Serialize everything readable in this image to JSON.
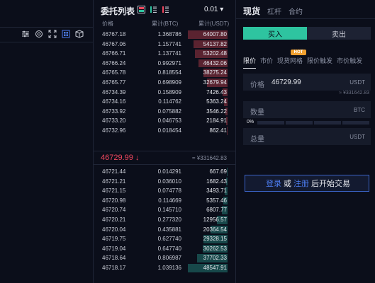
{
  "left_toolbar": {
    "icons": [
      "settings-sliders-icon",
      "eye-icon",
      "fullscreen-icon",
      "grid-layout-icon",
      "cube-icon"
    ]
  },
  "order_book": {
    "title": "委托列表",
    "precision": "0.01",
    "columns": {
      "price": "价格",
      "amount": "累计(BTC)",
      "total": "累计(USDT)"
    },
    "asks": [
      {
        "price": "46767.18",
        "amount": "1.368786",
        "total": "64007.80",
        "depth": 1.0
      },
      {
        "price": "46767.06",
        "amount": "1.157741",
        "total": "54137.82",
        "depth": 0.85
      },
      {
        "price": "46766.71",
        "amount": "1.137741",
        "total": "53202.48",
        "depth": 0.83
      },
      {
        "price": "46766.24",
        "amount": "0.992971",
        "total": "46432.06",
        "depth": 0.73
      },
      {
        "price": "46765.78",
        "amount": "0.818554",
        "total": "38275.24",
        "depth": 0.6
      },
      {
        "price": "46765.77",
        "amount": "0.698909",
        "total": "32679.94",
        "depth": 0.51
      },
      {
        "price": "46734.39",
        "amount": "0.158909",
        "total": "7426.43",
        "depth": 0.12
      },
      {
        "price": "46734.16",
        "amount": "0.114762",
        "total": "5363.24",
        "depth": 0.085
      },
      {
        "price": "46733.92",
        "amount": "0.075882",
        "total": "3546.22",
        "depth": 0.06
      },
      {
        "price": "46733.20",
        "amount": "0.046753",
        "total": "2184.91",
        "depth": 0.035
      },
      {
        "price": "46732.96",
        "amount": "0.018454",
        "total": "862.41",
        "depth": 0.015
      }
    ],
    "last_price": "46729.99 ↓",
    "last_price_usd": "≈ ¥331642.83",
    "bids": [
      {
        "price": "46721.44",
        "amount": "0.014291",
        "total": "667.69",
        "depth": 0.014
      },
      {
        "price": "46721.21",
        "amount": "0.036010",
        "total": "1682.43",
        "depth": 0.035
      },
      {
        "price": "46721.15",
        "amount": "0.074778",
        "total": "3493.71",
        "depth": 0.072
      },
      {
        "price": "46720.98",
        "amount": "0.114669",
        "total": "5357.46",
        "depth": 0.11
      },
      {
        "price": "46720.74",
        "amount": "0.145710",
        "total": "6807.77",
        "depth": 0.14
      },
      {
        "price": "46720.21",
        "amount": "0.277320",
        "total": "12956.57",
        "depth": 0.267
      },
      {
        "price": "46720.04",
        "amount": "0.435881",
        "total": "20364.54",
        "depth": 0.42
      },
      {
        "price": "46719.75",
        "amount": "0.627740",
        "total": "29328.15",
        "depth": 0.605
      },
      {
        "price": "46719.04",
        "amount": "0.647740",
        "total": "30262.53",
        "depth": 0.624
      },
      {
        "price": "46718.64",
        "amount": "0.806987",
        "total": "37702.33",
        "depth": 0.777
      },
      {
        "price": "46718.17",
        "amount": "1.039136",
        "total": "48547.91",
        "depth": 1.0
      }
    ]
  },
  "trade": {
    "tabs": [
      "现货",
      "杠杆",
      "合约"
    ],
    "buy_label": "买入",
    "sell_label": "卖出",
    "order_types": [
      "限价",
      "市价",
      "现货网格",
      "限价触发",
      "市价触发"
    ],
    "hot_badge": "HOT",
    "price_label": "价格",
    "price_value": "46729.99",
    "price_unit": "USDT",
    "price_approx": "≈ ¥331642.83",
    "qty_label": "数量",
    "qty_unit": "BTC",
    "slider_pct": "0%",
    "total_label": "总量",
    "total_unit": "USDT",
    "login_link": "登录",
    "login_or": "或",
    "register_link": "注册",
    "login_suffix": "后开始交易"
  },
  "colors": {
    "ask": "#f0475e",
    "bid": "#2ec4a0",
    "link": "#4c7cf0",
    "hot": "#f0a030"
  }
}
